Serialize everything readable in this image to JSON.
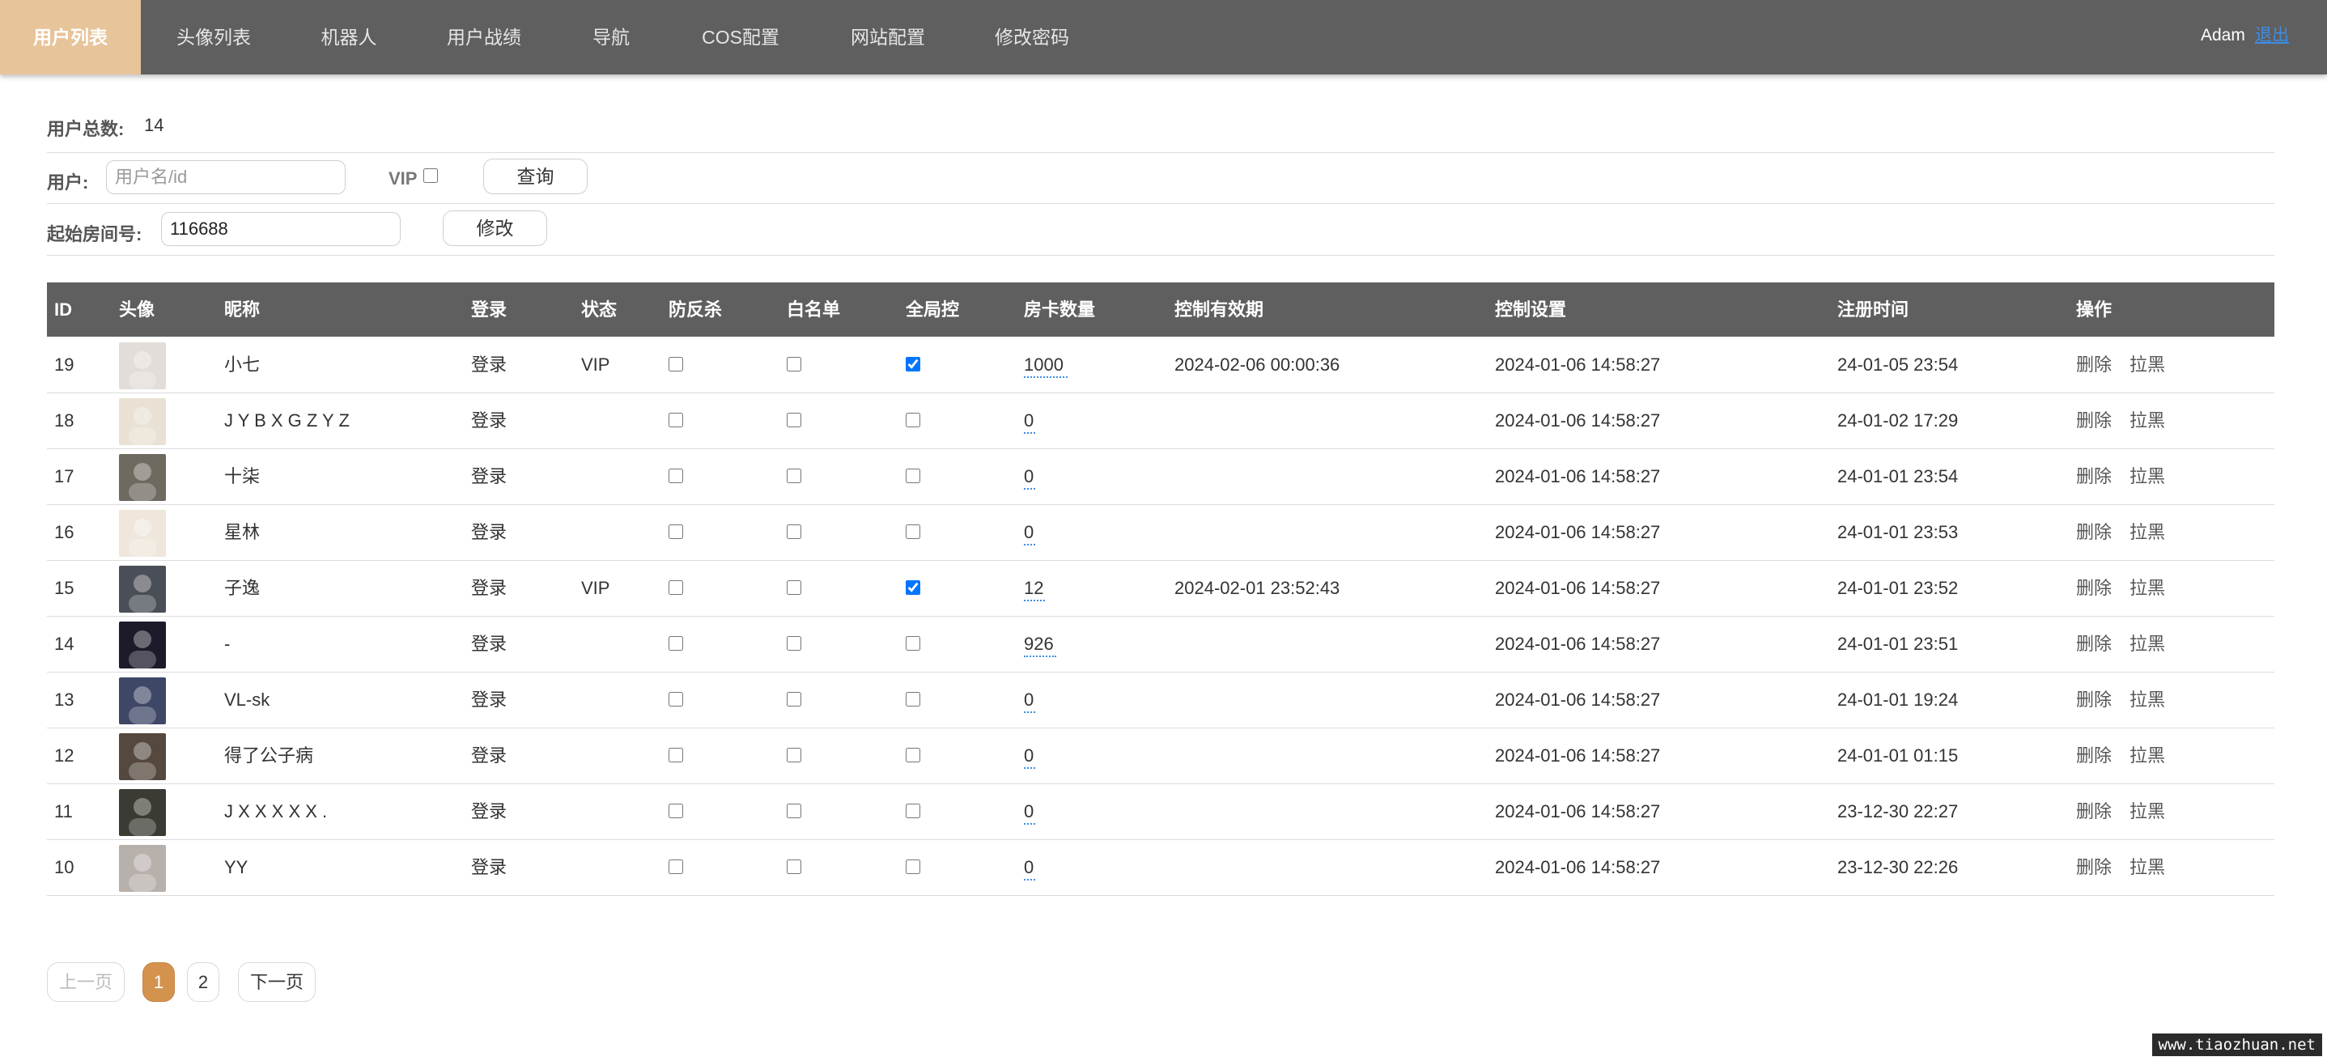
{
  "nav": {
    "items": [
      "用户列表",
      "头像列表",
      "机器人",
      "用户战绩",
      "导航",
      "COS配置",
      "网站配置",
      "修改密码"
    ],
    "active_index": 0,
    "user": "Adam",
    "logout": "退出"
  },
  "summary": {
    "total_label": "用户总数:",
    "total_value": "14"
  },
  "filter": {
    "user_label": "用户:",
    "user_placeholder": "用户名/id",
    "user_value": "",
    "vip_label": "VIP",
    "vip_checked": false,
    "query_button": "查询"
  },
  "room_start": {
    "label": "起始房间号:",
    "value": "116688",
    "modify_button": "修改"
  },
  "table": {
    "headers": [
      "ID",
      "头像",
      "昵称",
      "",
      "状态",
      "防反杀",
      "白名单",
      "全局控",
      "房卡数量",
      "控制有效期",
      "控制设置",
      "注册时间",
      "操作"
    ],
    "login_label": "登录",
    "delete_label": "删除",
    "blacklist_label": "拉黑",
    "rows": [
      {
        "id": "19",
        "nickname": "小七",
        "status": "VIP",
        "anti_kill": false,
        "whitelist": false,
        "global_control": true,
        "room_cards": "1000",
        "control_expiry": "2024-02-06 00:00:36",
        "control_setting": "2024-01-06 14:58:27",
        "registered": "24-01-05 23:54",
        "avatar_color": "#e2ddd8"
      },
      {
        "id": "18",
        "nickname": "J Y B X G Z Y Z",
        "status": "",
        "anti_kill": false,
        "whitelist": false,
        "global_control": false,
        "room_cards": "0",
        "control_expiry": "",
        "control_setting": "2024-01-06 14:58:27",
        "registered": "24-01-02 17:29",
        "avatar_color": "#e9e1d3"
      },
      {
        "id": "17",
        "nickname": "十柒",
        "status": "",
        "anti_kill": false,
        "whitelist": false,
        "global_control": false,
        "room_cards": "0",
        "control_expiry": "",
        "control_setting": "2024-01-06 14:58:27",
        "registered": "24-01-01 23:54",
        "avatar_color": "#6e6a60"
      },
      {
        "id": "16",
        "nickname": "星林",
        "status": "",
        "anti_kill": false,
        "whitelist": false,
        "global_control": false,
        "room_cards": "0",
        "control_expiry": "",
        "control_setting": "2024-01-06 14:58:27",
        "registered": "24-01-01 23:53",
        "avatar_color": "#efe6dc"
      },
      {
        "id": "15",
        "nickname": "子逸",
        "status": "VIP",
        "anti_kill": false,
        "whitelist": false,
        "global_control": true,
        "room_cards": "12",
        "control_expiry": "2024-02-01 23:52:43",
        "control_setting": "2024-01-06 14:58:27",
        "registered": "24-01-01 23:52",
        "avatar_color": "#4a4e56"
      },
      {
        "id": "14",
        "nickname": "-",
        "status": "",
        "anti_kill": false,
        "whitelist": false,
        "global_control": false,
        "room_cards": "926",
        "control_expiry": "",
        "control_setting": "2024-01-06 14:58:27",
        "registered": "24-01-01 23:51",
        "avatar_color": "#1d1a2a"
      },
      {
        "id": "13",
        "nickname": "VL-sk",
        "status": "",
        "anti_kill": false,
        "whitelist": false,
        "global_control": false,
        "room_cards": "0",
        "control_expiry": "",
        "control_setting": "2024-01-06 14:58:27",
        "registered": "24-01-01 19:24",
        "avatar_color": "#3e4766"
      },
      {
        "id": "12",
        "nickname": "得了公子病",
        "status": "",
        "anti_kill": false,
        "whitelist": false,
        "global_control": false,
        "room_cards": "0",
        "control_expiry": "",
        "control_setting": "2024-01-06 14:58:27",
        "registered": "24-01-01 01:15",
        "avatar_color": "#55483e"
      },
      {
        "id": "11",
        "nickname": "J X X X X X .",
        "status": "",
        "anti_kill": false,
        "whitelist": false,
        "global_control": false,
        "room_cards": "0",
        "control_expiry": "",
        "control_setting": "2024-01-06 14:58:27",
        "registered": "23-12-30 22:27",
        "avatar_color": "#3b3b33"
      },
      {
        "id": "10",
        "nickname": "YY",
        "status": "",
        "anti_kill": false,
        "whitelist": false,
        "global_control": false,
        "room_cards": "0",
        "control_expiry": "",
        "control_setting": "2024-01-06 14:58:27",
        "registered": "23-12-30 22:26",
        "avatar_color": "#b7b0ab"
      }
    ]
  },
  "pagination": {
    "prev": "上一页",
    "pages": [
      "1",
      "2"
    ],
    "current": "1",
    "next": "下一页"
  },
  "watermark": "www.tiaozhuan.net"
}
